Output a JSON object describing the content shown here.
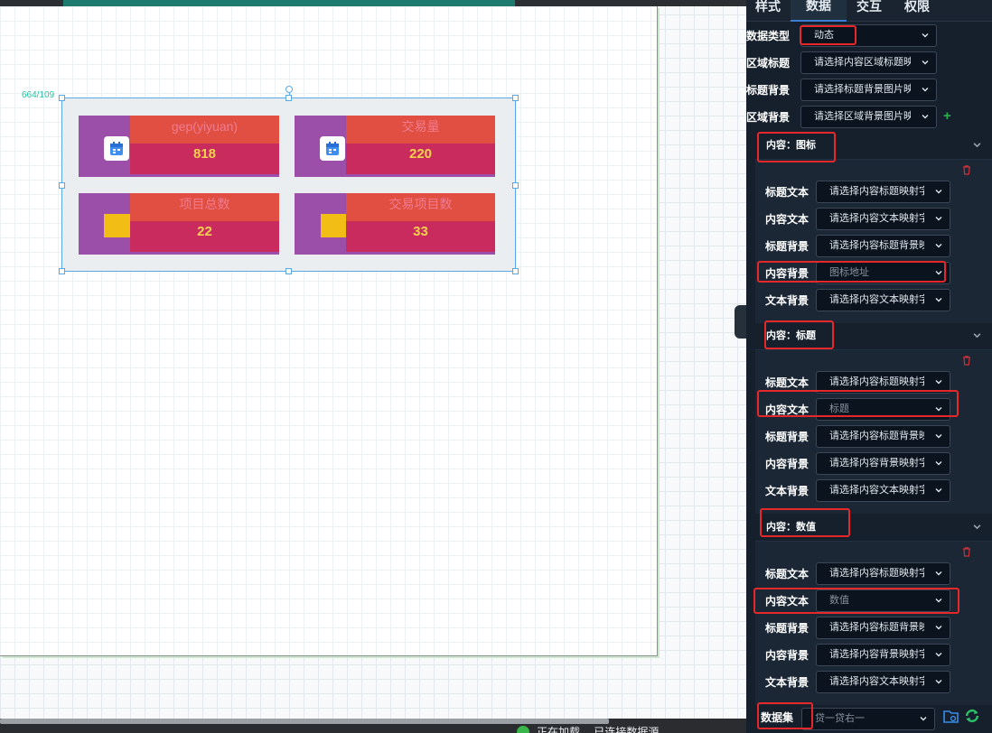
{
  "canvas": {
    "size_label": "664/109",
    "cards": [
      {
        "title": "gep(yiyuan)",
        "value": "818",
        "icon": "calendar-icon"
      },
      {
        "title": "交易量",
        "value": "220",
        "icon": "calendar-icon"
      },
      {
        "title": "项目总数",
        "value": "22",
        "icon": "yellow-square"
      },
      {
        "title": "交易项目数",
        "value": "33",
        "icon": "yellow-square"
      }
    ],
    "colors": {
      "card_bg": "#9b4fa9",
      "title_bg": "#e04f42",
      "value_bg": "#c92b5e",
      "value_text": "#f5d24d"
    }
  },
  "status": {
    "text": "正在加载… 已连接数据源"
  },
  "panel": {
    "tabs": [
      "样式",
      "数据",
      "交互",
      "权限"
    ],
    "active_tab": "数据",
    "top_fields": [
      {
        "label": "数据类型",
        "value": "动态"
      },
      {
        "label": "区域标题",
        "value": "请选择内容区域标题映射"
      },
      {
        "label": "标题背景",
        "value": "请选择标题背景图片映射"
      },
      {
        "label": "区域背景",
        "value": "请选择区域背景图片映射"
      }
    ],
    "sections": [
      {
        "title": "内容：图标",
        "fields": [
          {
            "label": "标题文本",
            "value": "请选择内容标题映射字段",
            "placeholder": false
          },
          {
            "label": "内容文本",
            "value": "请选择内容文本映射字段",
            "placeholder": false
          },
          {
            "label": "标题背景",
            "value": "请选择内容标题背景映射",
            "placeholder": false
          },
          {
            "label": "内容背景",
            "value": "图标地址",
            "placeholder": true
          },
          {
            "label": "文本背景",
            "value": "请选择内容文本映射字段",
            "placeholder": false
          }
        ]
      },
      {
        "title": "内容：标题",
        "fields": [
          {
            "label": "标题文本",
            "value": "请选择内容标题映射字段",
            "placeholder": false
          },
          {
            "label": "内容文本",
            "value": "标题",
            "placeholder": true
          },
          {
            "label": "标题背景",
            "value": "请选择内容标题背景映射",
            "placeholder": false
          },
          {
            "label": "内容背景",
            "value": "请选择内容背景映射字段",
            "placeholder": false
          },
          {
            "label": "文本背景",
            "value": "请选择内容文本映射字段",
            "placeholder": false
          }
        ]
      },
      {
        "title": "内容：数值",
        "fields": [
          {
            "label": "标题文本",
            "value": "请选择内容标题映射字段",
            "placeholder": false
          },
          {
            "label": "内容文本",
            "value": "数值",
            "placeholder": true
          },
          {
            "label": "标题背景",
            "value": "请选择内容标题背景映射",
            "placeholder": false
          },
          {
            "label": "内容背景",
            "value": "请选择内容背景映射字段",
            "placeholder": false
          },
          {
            "label": "文本背景",
            "value": "请选择内容文本映射字段",
            "placeholder": false
          }
        ]
      }
    ],
    "dataset": {
      "label": "数据集",
      "value": "贷一贷右一"
    },
    "annotation_color": "#e6282a"
  }
}
